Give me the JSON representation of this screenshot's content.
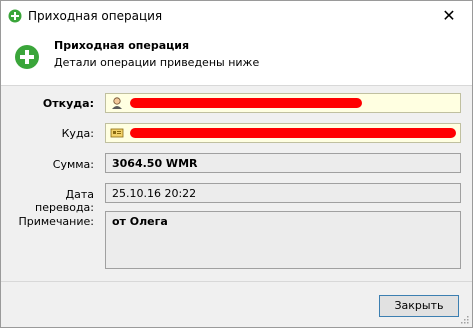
{
  "window": {
    "title": "Приходная операция",
    "close_glyph": "✕"
  },
  "header": {
    "title": "Приходная операция",
    "subtitle": "Детали операции приведены ниже",
    "icon": "plus-icon"
  },
  "form": {
    "from": {
      "label": "Откуда:",
      "value": ""
    },
    "to": {
      "label": "Куда:",
      "value": ""
    },
    "amount": {
      "label": "Сумма:",
      "value": "3064.50 WMR"
    },
    "date": {
      "label": "Дата перевода:",
      "value": "25.10.16 20:22"
    },
    "note": {
      "label": "Примечание:",
      "value": "от Олега"
    }
  },
  "footer": {
    "close_label": "Закрыть"
  },
  "colors": {
    "accent_green": "#3aa53a",
    "redaction": "#ff0000",
    "button_border": "#3c7fb1"
  }
}
